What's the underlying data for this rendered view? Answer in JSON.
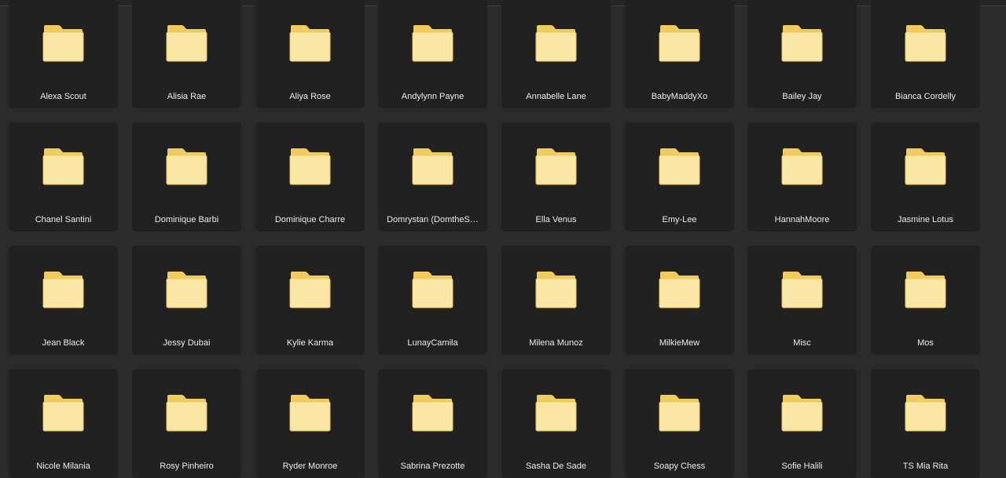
{
  "folders": [
    {
      "name": "Alexa Scout",
      "icon": "folder-icon"
    },
    {
      "name": "Alisia Rae",
      "icon": "folder-icon"
    },
    {
      "name": "Aliya Rose",
      "icon": "folder-icon"
    },
    {
      "name": "Andylynn Payne",
      "icon": "folder-icon"
    },
    {
      "name": "Annabelle Lane",
      "icon": "folder-icon"
    },
    {
      "name": "BabyMaddyXo",
      "icon": "folder-icon"
    },
    {
      "name": "Bailey Jay",
      "icon": "folder-icon"
    },
    {
      "name": "Bianca Cordelly",
      "icon": "folder-icon"
    },
    {
      "name": "Chanel Santini",
      "icon": "folder-icon"
    },
    {
      "name": "Dominique Barbi",
      "icon": "folder-icon"
    },
    {
      "name": "Dominique Charre",
      "icon": "folder-icon"
    },
    {
      "name": "Domrystan (DomtheS…",
      "icon": "folder-icon"
    },
    {
      "name": "Ella Venus",
      "icon": "folder-icon"
    },
    {
      "name": "Emy-Lee",
      "icon": "folder-icon"
    },
    {
      "name": "HannahMoore",
      "icon": "folder-icon"
    },
    {
      "name": "Jasmine Lotus",
      "icon": "folder-icon"
    },
    {
      "name": "Jean Black",
      "icon": "folder-icon"
    },
    {
      "name": "Jessy Dubai",
      "icon": "folder-icon"
    },
    {
      "name": "Kylie Karma",
      "icon": "folder-icon"
    },
    {
      "name": "LunayCamila",
      "icon": "folder-icon"
    },
    {
      "name": "Milena Munoz",
      "icon": "folder-icon"
    },
    {
      "name": "MilkieMew",
      "icon": "folder-icon"
    },
    {
      "name": "Misc",
      "icon": "folder-icon"
    },
    {
      "name": "Mos",
      "icon": "folder-icon"
    },
    {
      "name": "Nicole Milania",
      "icon": "folder-icon"
    },
    {
      "name": "Rosy Pinheiro",
      "icon": "folder-icon"
    },
    {
      "name": "Ryder Monroe",
      "icon": "folder-icon"
    },
    {
      "name": "Sabrina Prezotte",
      "icon": "folder-icon"
    },
    {
      "name": "Sasha De Sade",
      "icon": "folder-icon"
    },
    {
      "name": "Soapy Chess",
      "icon": "folder-icon"
    },
    {
      "name": "Sofie Halili",
      "icon": "folder-icon"
    },
    {
      "name": "TS Mia Rita",
      "icon": "folder-icon"
    }
  ],
  "colors": {
    "background": "#2b2b2b",
    "tile": "#212121",
    "folder_back": "#f2cb5e",
    "folder_front": "#fbe7a5",
    "label": "#ececec"
  }
}
